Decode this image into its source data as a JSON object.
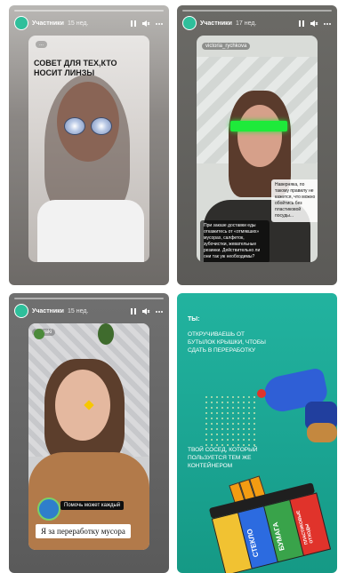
{
  "panels": [
    {
      "header": {
        "name": "Участники",
        "time": "15 нед."
      },
      "handle": "...",
      "headline": "СОВЕТ ДЛЯ ТЕХ,КТО НОСИТ ЛИНЗЫ"
    },
    {
      "header": {
        "name": "Участники",
        "time": "17 нед."
      },
      "handle": "victoria_rychkova",
      "headline_main": "При заказе доставки еды откажитесь от «отмякших» мусорах, салфеток, зубочистки, жевательные резинки. Действительно ли они так уж необходимы?",
      "headline_small": "Наверняка, по такому правилу не кажется, что можно обойтись без пластиковой посуды..."
    },
    {
      "header": {
        "name": "Участники",
        "time": "15 нед."
      },
      "handle": "kalyaki",
      "badge": "Помочь может каждый",
      "caption": "Я за переработку мусора"
    },
    {
      "label_you": "ТЫ:",
      "text_top": "ОТКРУЧИВАЕШЬ ОТ БУТЫЛОК КРЫШКИ, ЧТОБЫ СДАТЬ В ПЕРЕРАБОТКУ",
      "text_bottom": "ТВОЙ СОСЕД, КОТОРЫЙ ПОЛЬЗУЕТСЯ ТЕМ ЖЕ КОНТЕЙНЕРОМ",
      "bin_labels": [
        "СТЕКЛО",
        "БУМАГА",
        "ПЛАСТИКОВЫЕ ОТХОДЫ"
      ]
    }
  ],
  "colors": {
    "teal": "#1aa391",
    "bin_yellow": "#f1c232",
    "bin_blue": "#2c6be0",
    "bin_green": "#39a34a",
    "bin_red": "#e0332b"
  }
}
